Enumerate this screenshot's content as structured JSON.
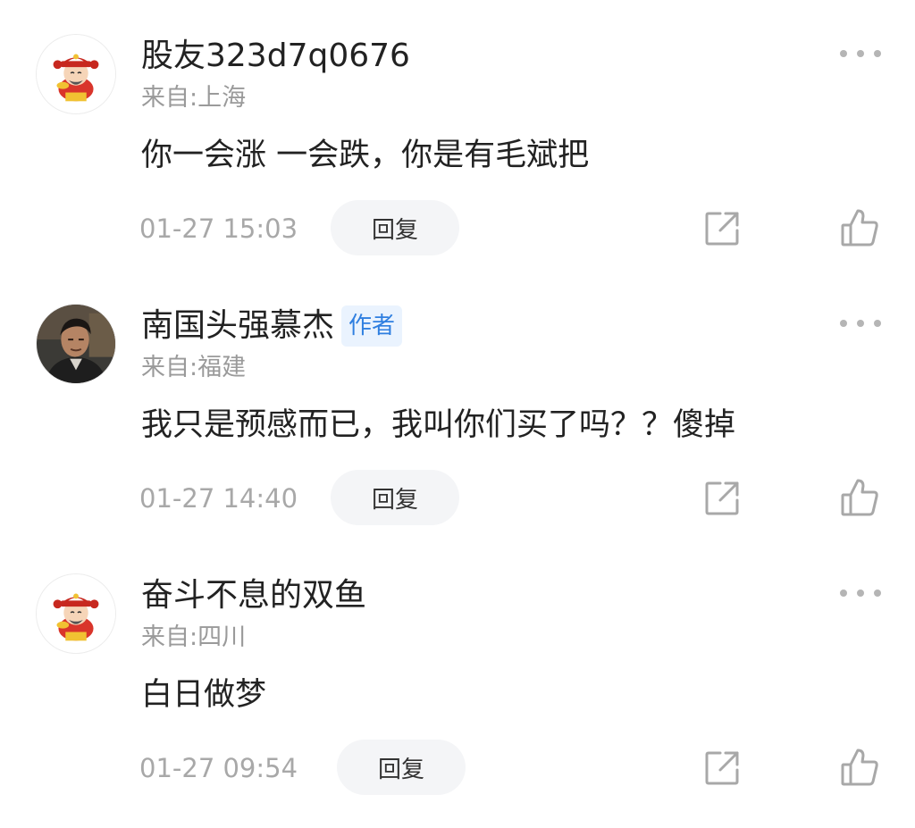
{
  "comments": [
    {
      "username": "股友323d7q0676",
      "location": "来自:上海",
      "content": "你一会涨 一会跌，你是有毛斌把",
      "timestamp": "01-27 15:03",
      "reply_label": "回复",
      "avatar_icon": "cartoon-fortune-god-avatar",
      "is_author": false
    },
    {
      "username": "南国头强慕杰",
      "badge": "作者",
      "location": "来自:福建",
      "content": "我只是预感而已，我叫你们买了吗？？傻掉",
      "timestamp": "01-27 14:40",
      "reply_label": "回复",
      "avatar_icon": "man-in-suit-photo-avatar",
      "is_author": true
    },
    {
      "username": "奋斗不息的双鱼",
      "location": "来自:四川",
      "content": "白日做梦",
      "timestamp": "01-27 09:54",
      "reply_label": "回复",
      "avatar_icon": "cartoon-fortune-god-avatar",
      "is_author": false
    }
  ],
  "colors": {
    "text_primary": "#222222",
    "text_secondary": "#9a9a9a",
    "badge_bg": "#eaf3fe",
    "badge_text": "#2f7fe0",
    "reply_bg": "#f4f5f7",
    "icon_gray": "#a8a8a8"
  }
}
